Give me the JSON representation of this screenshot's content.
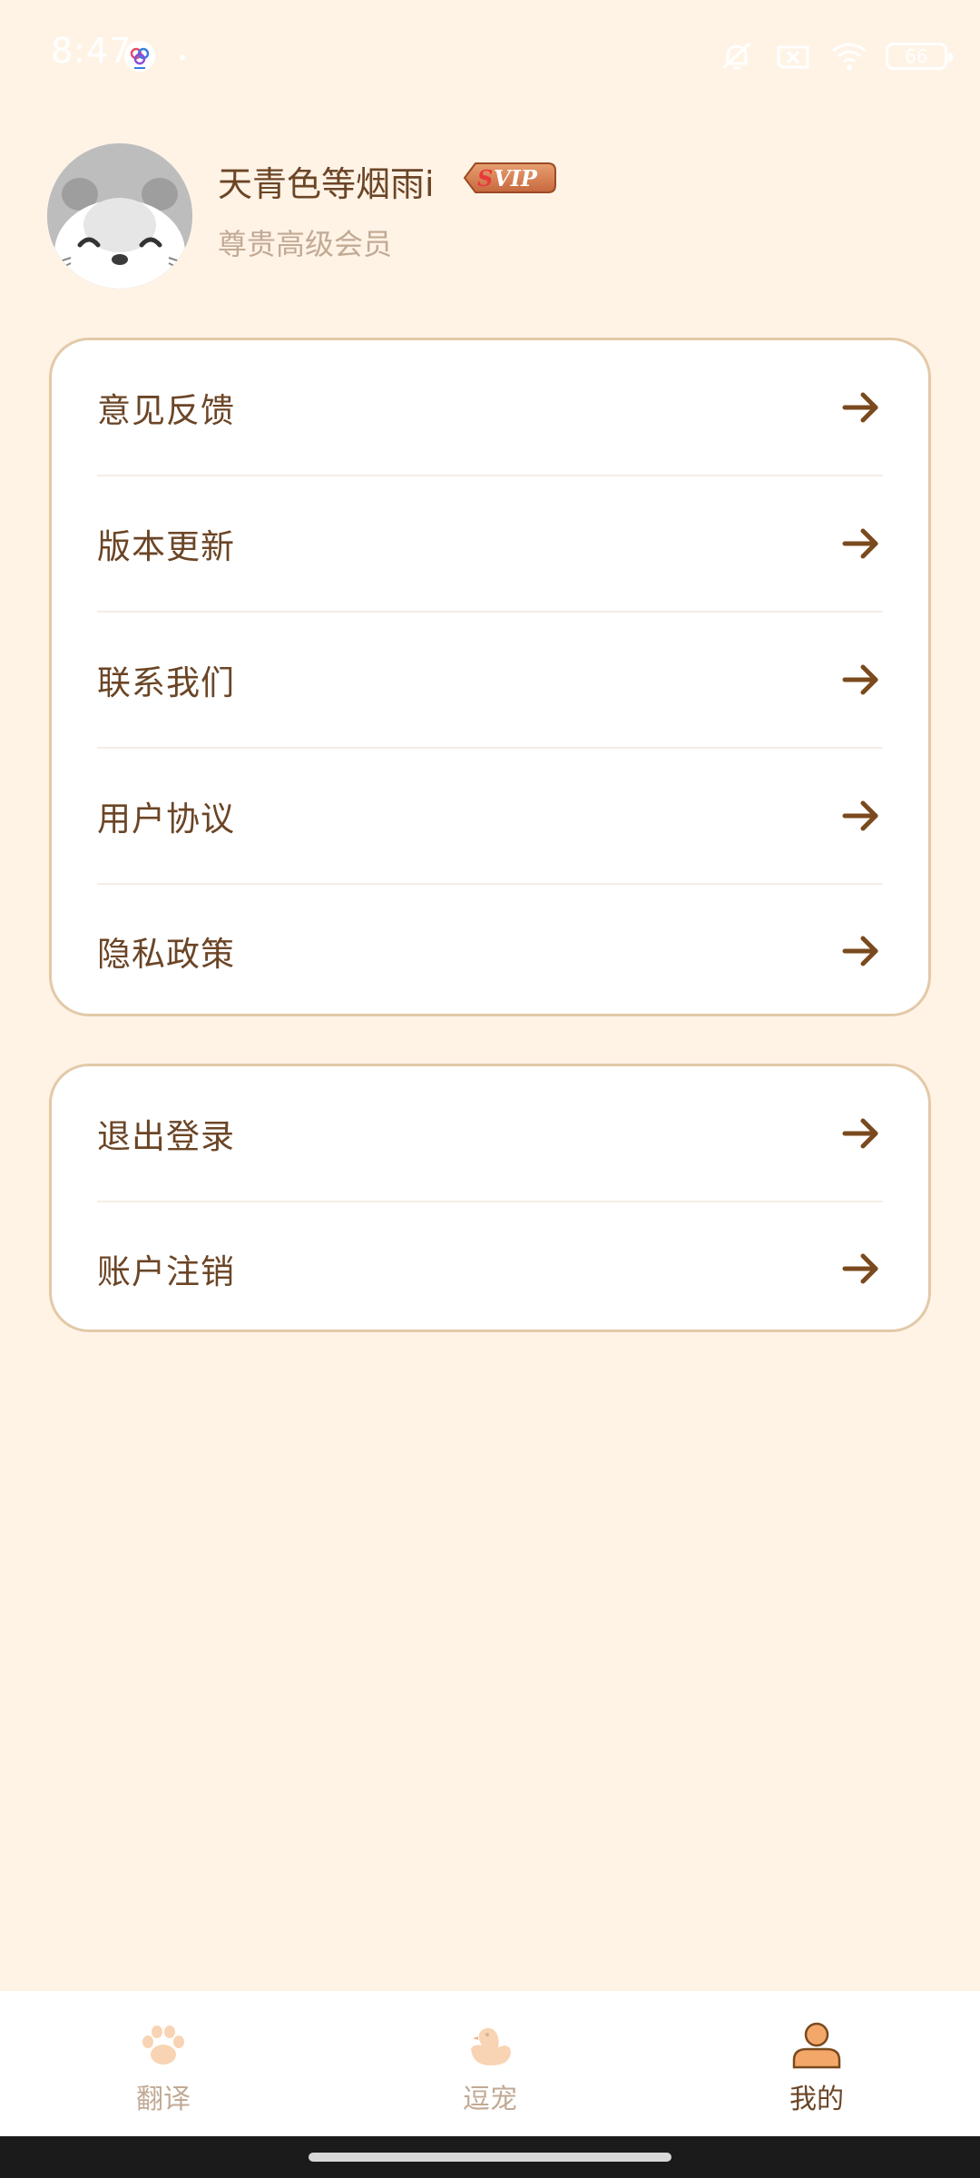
{
  "status_bar": {
    "time": "8:47",
    "battery": "66"
  },
  "profile": {
    "name": "天青色等烟雨i",
    "badge": "SVIP",
    "subtitle": "尊贵高级会员"
  },
  "menu_group_1": [
    {
      "label": "意见反馈"
    },
    {
      "label": "版本更新"
    },
    {
      "label": "联系我们"
    },
    {
      "label": "用户协议"
    },
    {
      "label": "隐私政策"
    }
  ],
  "menu_group_2": [
    {
      "label": "退出登录"
    },
    {
      "label": "账户注销"
    }
  ],
  "bottom_nav": {
    "items": [
      {
        "label": "翻译",
        "icon": "paw-icon",
        "active": false
      },
      {
        "label": "逗宠",
        "icon": "duck-icon",
        "active": false
      },
      {
        "label": "我的",
        "icon": "person-icon",
        "active": true
      }
    ]
  },
  "colors": {
    "background": "#FFF3E6",
    "text_primary": "#6B4526",
    "text_secondary": "#C2AA95",
    "card_border": "#E3C9A8",
    "accent": "#F3A86A"
  }
}
